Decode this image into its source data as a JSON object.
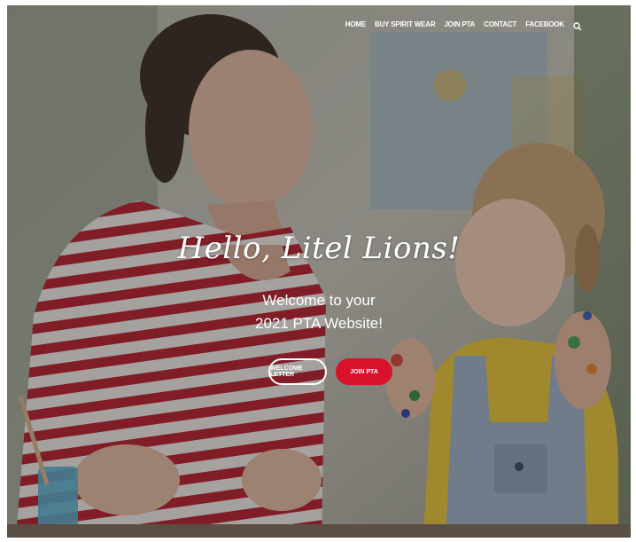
{
  "nav": {
    "items": [
      "HOME",
      "BUY SPIRIT WEAR",
      "JOIN PTA",
      "CONTACT",
      "FACEBOOK"
    ],
    "search_icon": "search-icon"
  },
  "hero": {
    "headline": "Hello, Litel Lions!",
    "welcome_line1": "Welcome to your",
    "welcome_line2": "2021 PTA Website!"
  },
  "buttons": {
    "welcome_letter": "WELCOME LETTER",
    "join_pta": "JOIN PTA"
  },
  "colors": {
    "primary_button": "#d7122a",
    "text": "#ffffff"
  }
}
